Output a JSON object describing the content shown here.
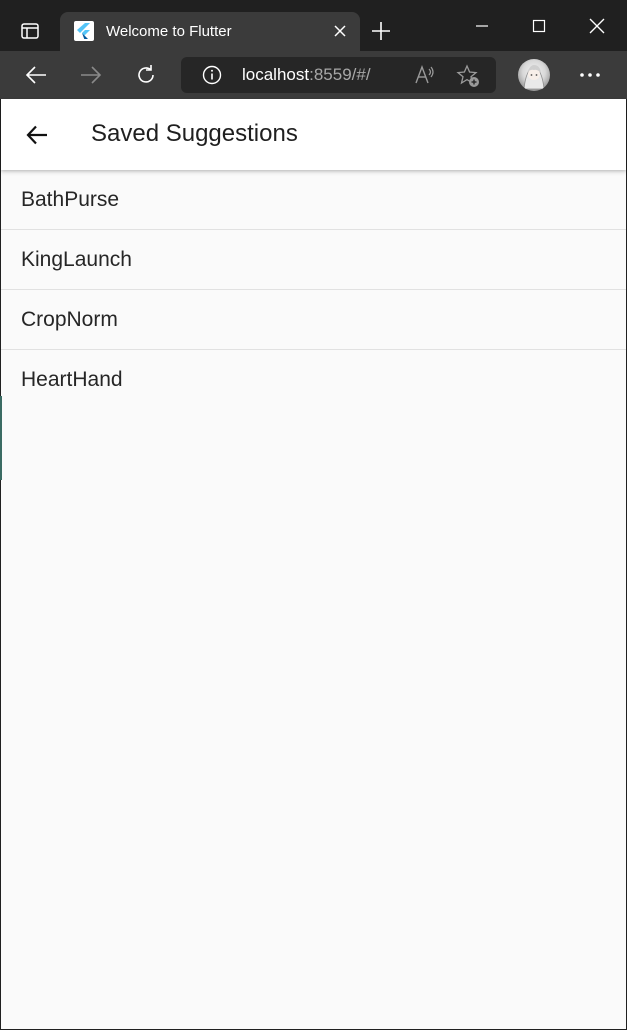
{
  "browser": {
    "tab": {
      "title": "Welcome to Flutter",
      "favicon": "flutter-logo-icon"
    },
    "address": {
      "host": "localhost",
      "rest": ":8559/#/"
    },
    "icons": {
      "tab_actions": "tab-actions-icon",
      "close_tab": "close-icon",
      "new_tab": "plus-icon",
      "minimize": "minimize-icon",
      "maximize": "maximize-icon",
      "close_window": "close-icon",
      "back": "arrow-left-icon",
      "forward": "arrow-right-icon",
      "refresh": "refresh-icon",
      "site_info": "info-icon",
      "read_aloud": "read-aloud-icon",
      "add_favorite": "star-add-icon",
      "profile": "avatar",
      "more": "ellipsis-icon"
    },
    "colors": {
      "titlebar": "#202020",
      "toolbar": "#3b3b3b",
      "addressbar": "#262626"
    }
  },
  "app": {
    "appbar": {
      "title": "Saved Suggestions",
      "back_icon": "arrow-left-icon"
    },
    "saved": [
      {
        "label": "BathPurse"
      },
      {
        "label": "KingLaunch"
      },
      {
        "label": "CropNorm"
      },
      {
        "label": "HeartHand"
      }
    ],
    "colors": {
      "appbar": "#ffffff",
      "background": "#fafafa",
      "divider": "#e1e1e1"
    }
  }
}
